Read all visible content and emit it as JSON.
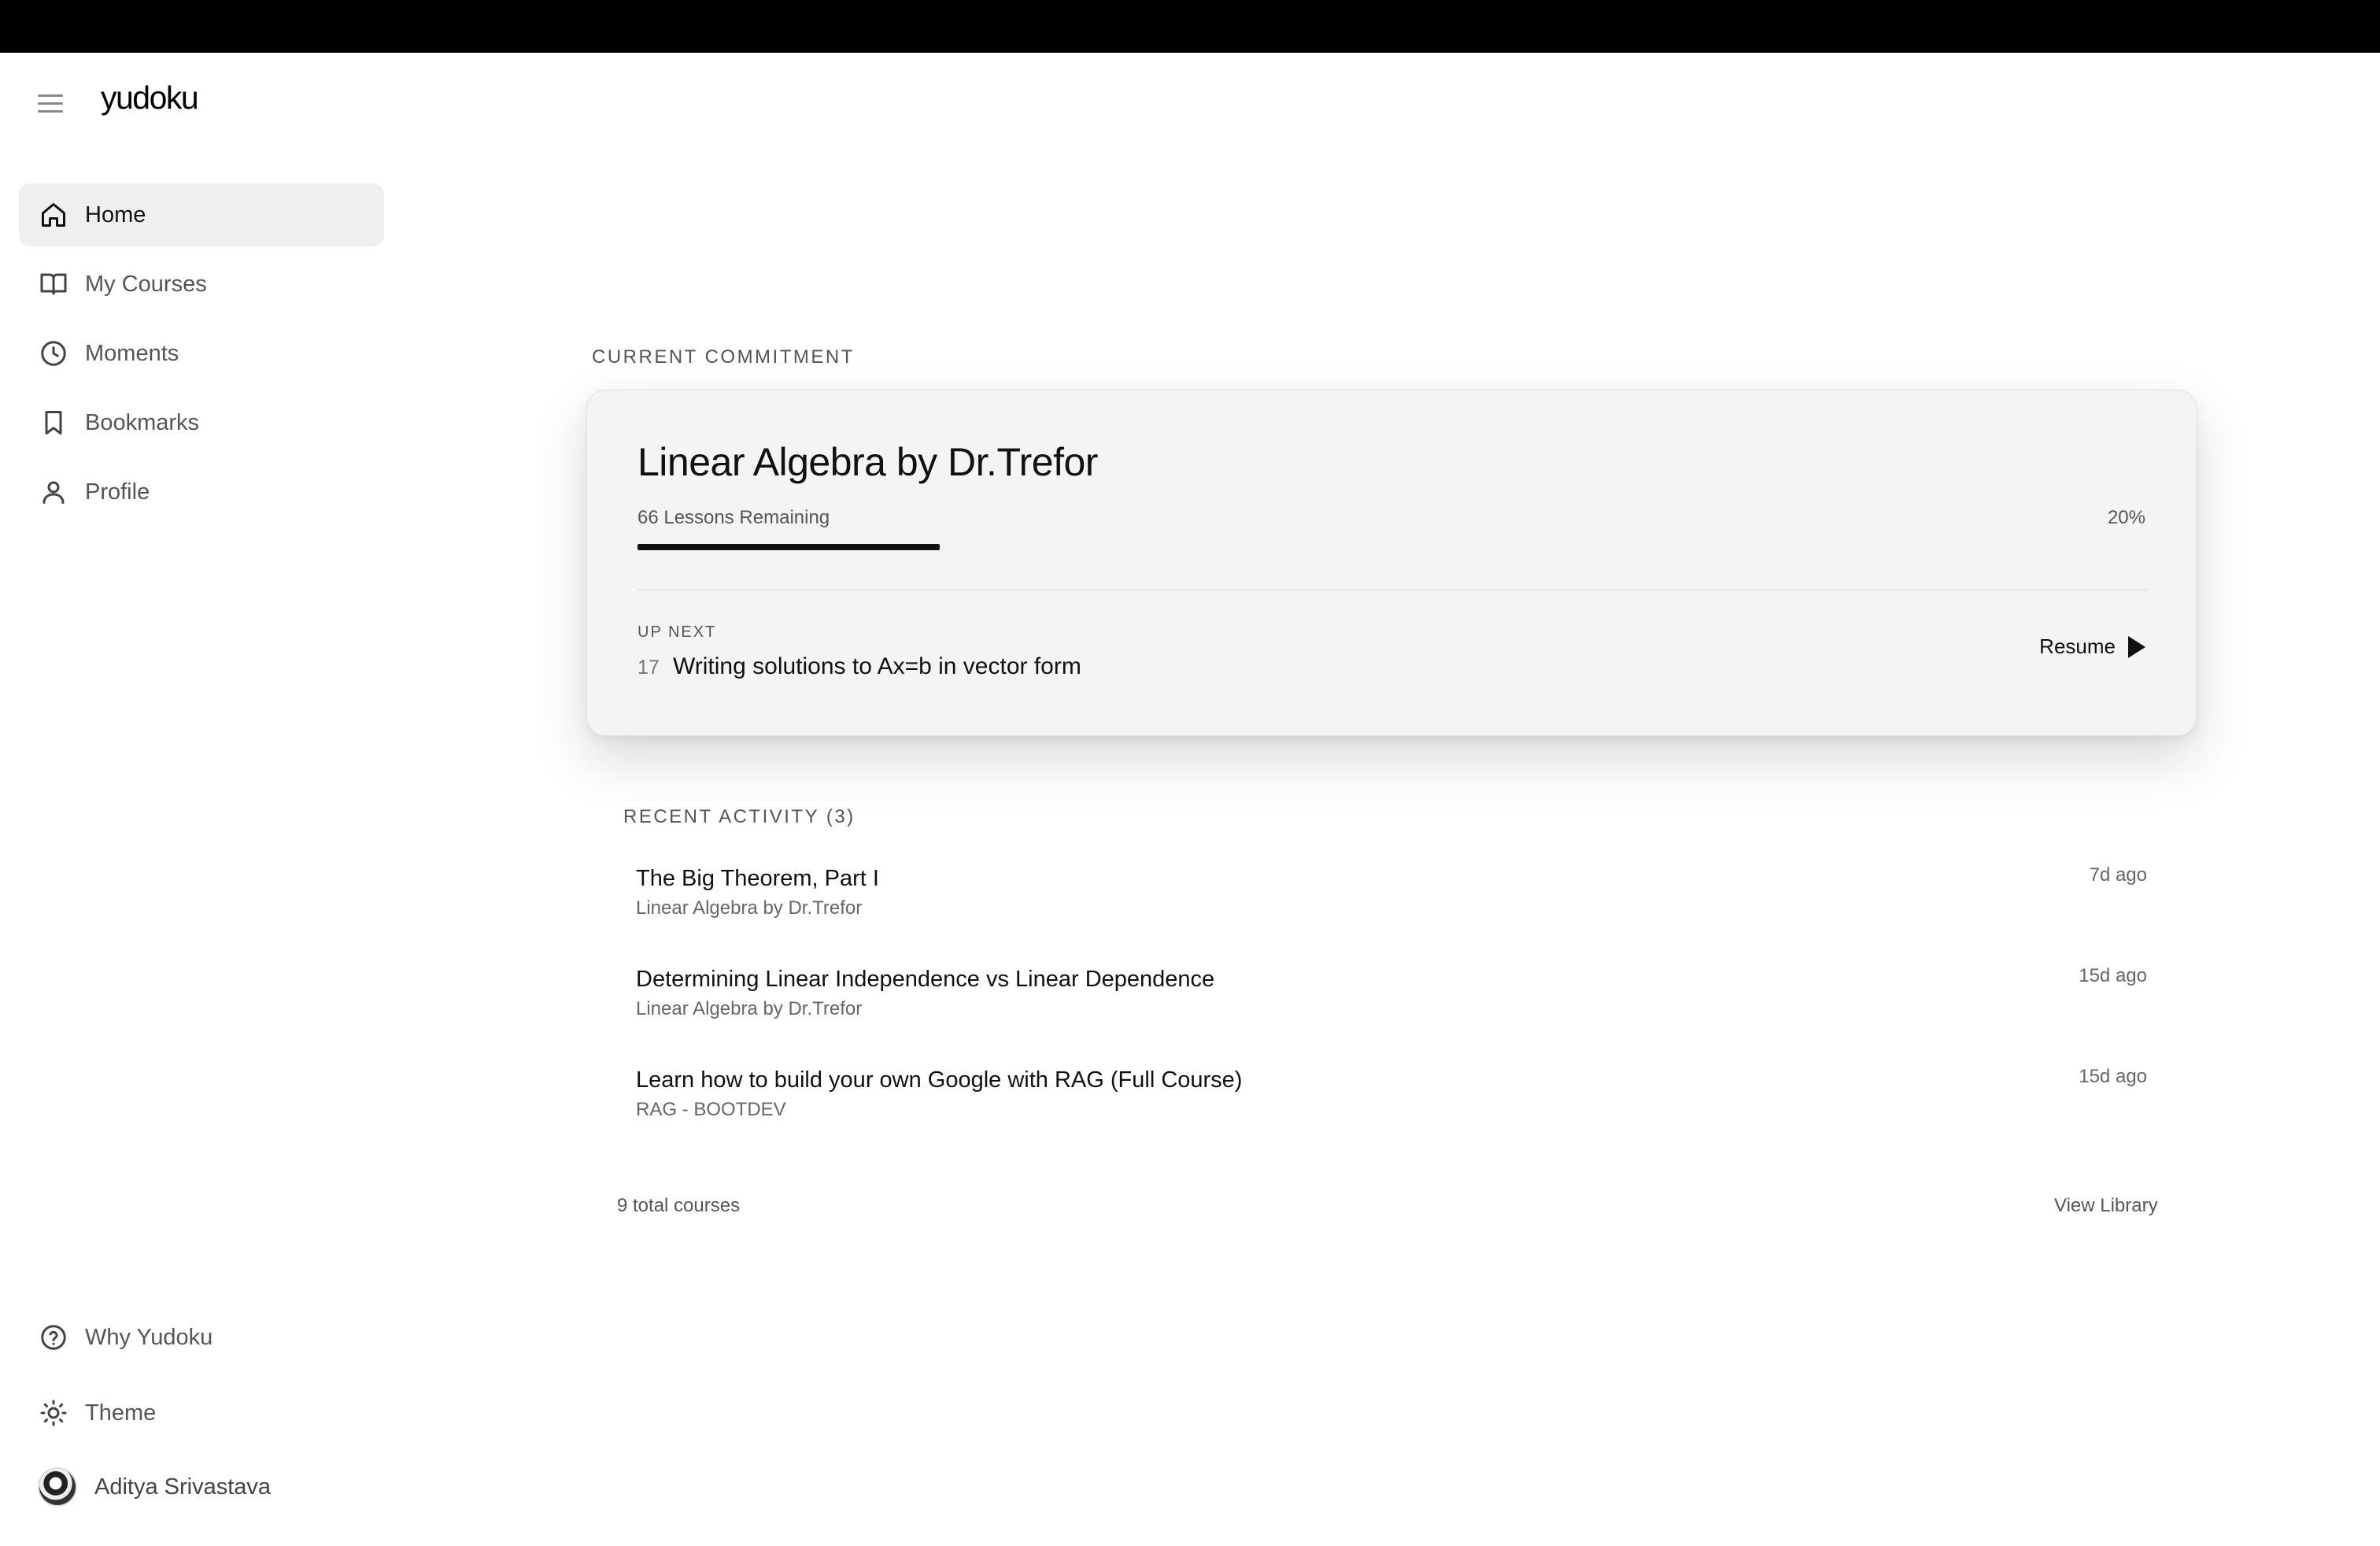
{
  "app": {
    "logo": "yudoku"
  },
  "sidebar": {
    "items": [
      {
        "label": "Home",
        "icon": "home-icon",
        "active": true
      },
      {
        "label": "My Courses",
        "icon": "book-icon",
        "active": false
      },
      {
        "label": "Moments",
        "icon": "clock-icon",
        "active": false
      },
      {
        "label": "Bookmarks",
        "icon": "bookmark-icon",
        "active": false
      },
      {
        "label": "Profile",
        "icon": "user-icon",
        "active": false
      }
    ],
    "bottom": [
      {
        "label": "Why Yudoku",
        "icon": "help-circle-icon"
      },
      {
        "label": "Theme",
        "icon": "sun-icon"
      }
    ],
    "user": {
      "name": "Aditya Srivastava"
    }
  },
  "commitment": {
    "section_label": "CURRENT COMMITMENT",
    "course_title": "Linear Algebra by Dr.Trefor",
    "lessons_remaining": "66 Lessons Remaining",
    "progress_percent": 20,
    "progress_label": "20%",
    "up_next_label": "UP NEXT",
    "up_next_number": "17",
    "up_next_title": "Writing solutions to Ax=b in vector form",
    "resume_label": "Resume"
  },
  "recent": {
    "section_label": "RECENT ACTIVITY (3)",
    "items": [
      {
        "title": "The Big Theorem, Part I",
        "course": "Linear Algebra by Dr.Trefor",
        "time": "7d ago"
      },
      {
        "title": "Determining Linear Independence vs Linear Dependence",
        "course": "Linear Algebra by Dr.Trefor",
        "time": "15d ago"
      },
      {
        "title": "Learn how to build your own Google with RAG (Full Course)",
        "course": "RAG - BOOTDEV",
        "time": "15d ago"
      }
    ]
  },
  "footer": {
    "total_courses": "9 total courses",
    "view_library": "View Library"
  },
  "colors": {
    "accent": "#111111",
    "card_bg": "#f4f4f4",
    "active_nav_bg": "#efefef"
  }
}
